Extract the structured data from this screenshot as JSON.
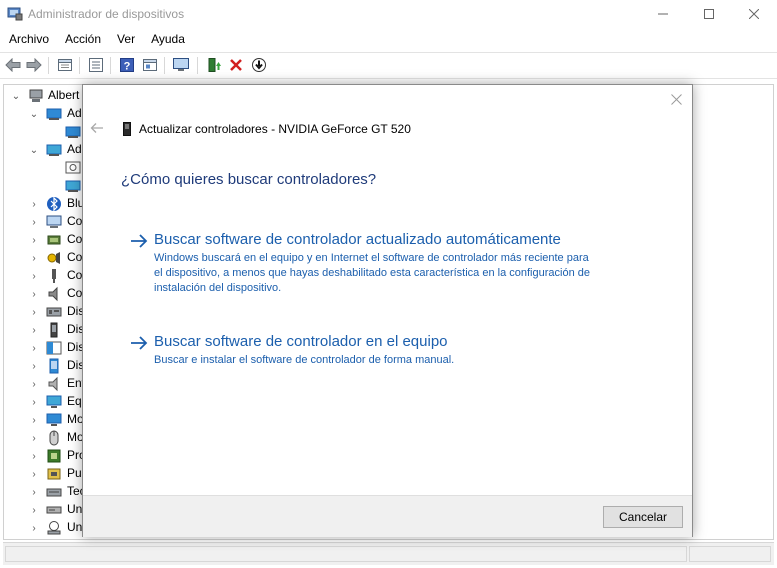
{
  "window": {
    "title": "Administrador de dispositivos"
  },
  "menu": [
    "Archivo",
    "Acción",
    "Ver",
    "Ayuda"
  ],
  "toolbar": {
    "icons": [
      "back-arrow-icon",
      "forward-arrow-icon",
      "properties-icon",
      "computer-list-icon",
      "help-icon",
      "view-icon",
      "monitor-icon",
      "update-driver-icon",
      "uninstall-icon",
      "disable-icon"
    ],
    "uninstall_color": "#d21f1f"
  },
  "tree": {
    "root_label": "Albert",
    "items": [
      {
        "label": "Ad",
        "icon": "display-adapter-icon",
        "expanded": true,
        "child": true
      },
      {
        "label": "",
        "icon": "display-adapter-icon",
        "child_level": 2
      },
      {
        "label": "Ad",
        "icon": "network-adapter-icon",
        "expanded": true,
        "child": true
      },
      {
        "label": "",
        "icon": "network-adapter-icon",
        "child_level": 2
      },
      {
        "label": "",
        "icon": "network-adapter-icon",
        "child_level": 2
      },
      {
        "label": "Blu",
        "icon": "bluetooth-icon"
      },
      {
        "label": "Co",
        "icon": "computer-icon"
      },
      {
        "label": "Co",
        "icon": "controller-icon"
      },
      {
        "label": "Co",
        "icon": "sound-controller-icon"
      },
      {
        "label": "Co",
        "icon": "usb-controller-icon"
      },
      {
        "label": "Co",
        "icon": "audio-input-icon"
      },
      {
        "label": "Dis",
        "icon": "disk-drive-icon"
      },
      {
        "label": "Dis",
        "icon": "portable-device-icon"
      },
      {
        "label": "Dis",
        "icon": "hid-device-icon"
      },
      {
        "label": "Dis",
        "icon": "device-icon"
      },
      {
        "label": "Ent",
        "icon": "speaker-icon"
      },
      {
        "label": "Eq",
        "icon": "monitor-icon"
      },
      {
        "label": "Mo",
        "icon": "display-icon"
      },
      {
        "label": "Mo",
        "icon": "mouse-icon"
      },
      {
        "label": "Pro",
        "icon": "processor-icon"
      },
      {
        "label": "Pu",
        "icon": "port-icon"
      },
      {
        "label": "Tec",
        "icon": "keyboard-icon"
      },
      {
        "label": "Un",
        "icon": "dvd-drive-icon"
      },
      {
        "label": "Un",
        "icon": "storage-icon"
      }
    ]
  },
  "dialog": {
    "title": "Actualizar controladores - NVIDIA GeForce GT 520",
    "question": "¿Cómo quieres buscar controladores?",
    "option1": {
      "title": "Buscar software de controlador actualizado automáticamente",
      "description": "Windows buscará en el equipo y en Internet el software de controlador más reciente para el dispositivo, a menos que hayas deshabilitado esta característica en la configuración de instalación del dispositivo."
    },
    "option2": {
      "title": "Buscar software de controlador en el equipo",
      "description": "Buscar e instalar el software de controlador de forma manual."
    },
    "cancel_label": "Cancelar",
    "link_color": "#1c5fad",
    "heading_color": "#1f3b7a"
  }
}
